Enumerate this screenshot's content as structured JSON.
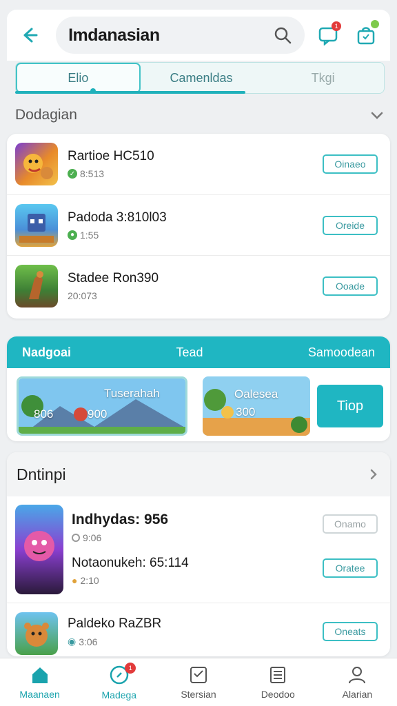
{
  "header": {
    "title": "Imdanasian",
    "back_icon": "arrow-left-icon",
    "search_icon": "search-icon",
    "chat_icon": "chat-icon",
    "chat_badge": "1",
    "bag_icon": "shopping-bag-icon"
  },
  "tabs": [
    {
      "label": "Elio"
    },
    {
      "label": "Camenldas"
    },
    {
      "label": "Tkgi"
    }
  ],
  "section1": {
    "label": "Dodagian"
  },
  "list1": [
    {
      "title": "Rartioe HC510",
      "sub": "8:513",
      "button": "Oinaeo",
      "status": "check"
    },
    {
      "title": "Padoda 3:810l03",
      "sub": "1:55",
      "button": "Oreide",
      "status": "people"
    },
    {
      "title": "Stadee Ron390",
      "sub": "20:073",
      "button": "Ooade",
      "status": "none"
    }
  ],
  "promo": {
    "bar_left": "Nadgoai",
    "bar_mid": "Tead",
    "bar_right": "Samoodean",
    "banner1_title": "Tuserahah",
    "banner1_count": "806",
    "banner1_count2": "900",
    "banner2_title": "Oalesea",
    "banner2_count": "300",
    "button": "Tiop"
  },
  "section2": {
    "label": "Dntinpi"
  },
  "list2": [
    {
      "title": "Indhydas: 956",
      "sub": "9:06",
      "button": "Onamo"
    },
    {
      "title": "Notaonukeh: 65:114",
      "sub": "2:10",
      "button": "Oratee"
    },
    {
      "title": "Paldeko RaZBR",
      "sub": "3:06",
      "button": "Oneats"
    }
  ],
  "nav": [
    {
      "label": "Maanaen",
      "icon": "home-icon"
    },
    {
      "label": "Madega",
      "icon": "compass-icon",
      "badge": "1"
    },
    {
      "label": "Stersian",
      "icon": "list-check-icon"
    },
    {
      "label": "Deodoo",
      "icon": "document-icon"
    },
    {
      "label": "Alarian",
      "icon": "user-icon"
    }
  ],
  "colors": {
    "accent": "#1fb6c2",
    "badge": "#e23b3b",
    "check": "#4caf50"
  }
}
